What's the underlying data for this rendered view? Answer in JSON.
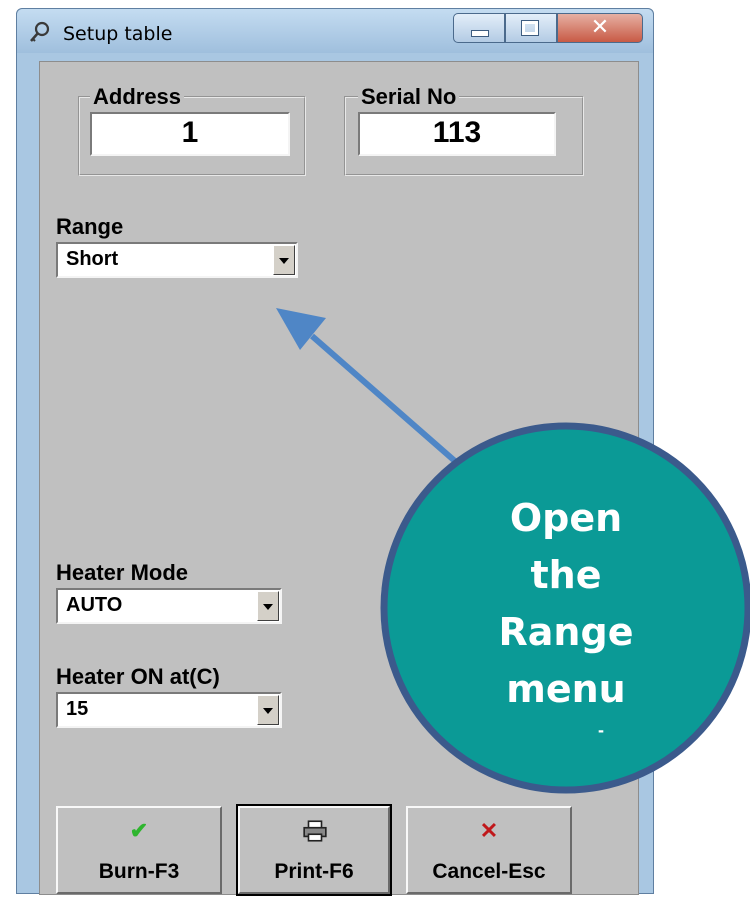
{
  "window": {
    "title": "Setup table",
    "title_icon": "key-icon"
  },
  "address": {
    "label": "Address",
    "value": "1"
  },
  "serial": {
    "label": "Serial No",
    "value": "113"
  },
  "range": {
    "label": "Range",
    "value": "Short"
  },
  "heater_mode": {
    "label": "Heater Mode",
    "value": "AUTO"
  },
  "heater_on": {
    "label": "Heater ON at(C)",
    "value": "15"
  },
  "buttons": [
    {
      "label": "Burn-F3",
      "icon": "checkmark-icon",
      "icon_color": "#2eb52e"
    },
    {
      "label": "Print-F6",
      "icon": "printer-icon"
    },
    {
      "label": "Cancel-Esc",
      "icon": "cross-icon",
      "icon_color": "#c0181b"
    }
  ],
  "callout": {
    "lines": [
      "Open",
      "the",
      "Range",
      "menu"
    ],
    "mark": "-",
    "fill_color": "#0b9a96",
    "border_color": "#3b5a8c",
    "arrow_color": "#4f86c6"
  }
}
